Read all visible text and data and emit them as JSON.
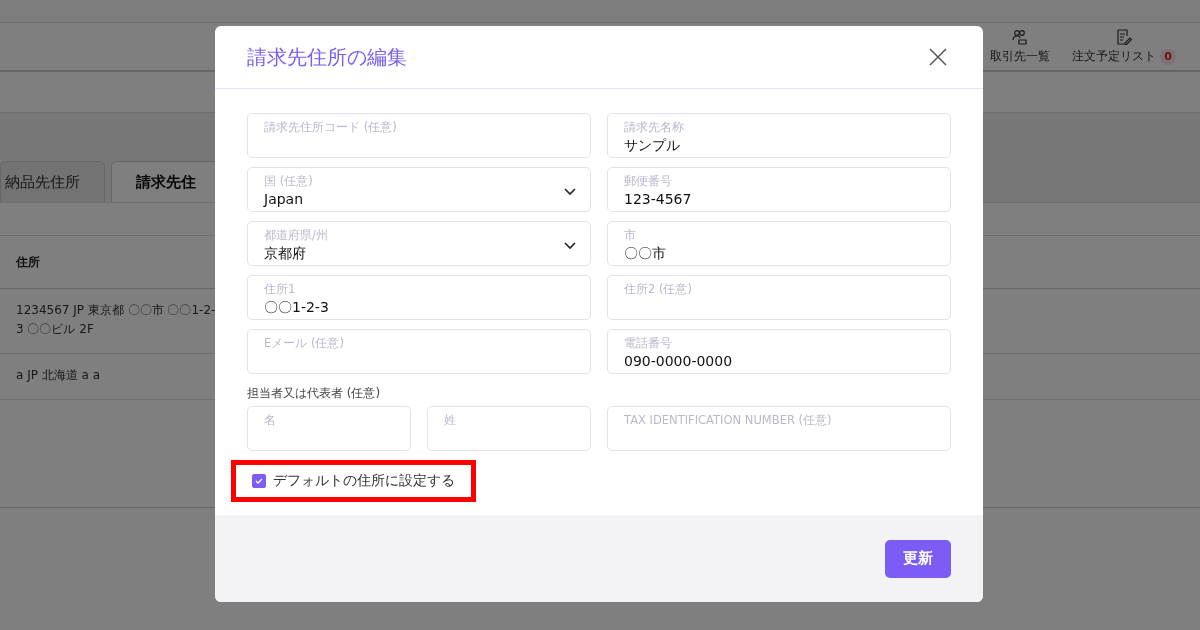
{
  "header": {
    "nav": [
      {
        "kind": "partners",
        "label": "取引先一覧"
      },
      {
        "kind": "orders",
        "label": "注文予定リスト",
        "badge": "0"
      }
    ]
  },
  "tabs": [
    {
      "label": "納品先住所",
      "selected": false
    },
    {
      "label": "請求先住",
      "selected": true
    }
  ],
  "table": {
    "columns": [
      "住所"
    ],
    "rows": [
      [
        "1234567 JP 東京都 〇〇市 〇〇1-2-3 〇〇ビル 2F"
      ],
      [
        "a JP 北海道 a a"
      ]
    ]
  },
  "dialog": {
    "title": "請求先住所の編集",
    "fields": [
      {
        "kind": "text",
        "label": "請求先住所コード (任意)"
      },
      {
        "kind": "text",
        "label": "請求先名称",
        "value": "サンプル"
      },
      {
        "kind": "select",
        "label": "国 (任意)",
        "value": "Japan"
      },
      {
        "kind": "text",
        "label": "郵便番号",
        "value": "123-4567"
      },
      {
        "kind": "select",
        "label": "都道府県/州",
        "value": "京都府"
      },
      {
        "kind": "text",
        "label": "市",
        "value": "〇〇市"
      },
      {
        "kind": "text",
        "label": "住所1",
        "value": "〇〇1-2-3"
      },
      {
        "kind": "text",
        "label": "住所2 (任意)"
      },
      {
        "kind": "text",
        "label": "Eメール (任意)"
      },
      {
        "kind": "text",
        "label": "電話番号",
        "value": "090-0000-0000"
      }
    ],
    "contact": {
      "label": "担当者又は代表者 (任意)",
      "fields": [
        {
          "kind": "text",
          "label": "名"
        },
        {
          "kind": "text",
          "label": "姓"
        }
      ]
    },
    "tax_field": {
      "kind": "text",
      "label": "TAX IDENTIFICATION NUMBER (任意)"
    },
    "default_checkbox": {
      "label": "デフォルトの住所に設定する",
      "checked": true,
      "highlighted": true
    },
    "submit": "更新"
  }
}
